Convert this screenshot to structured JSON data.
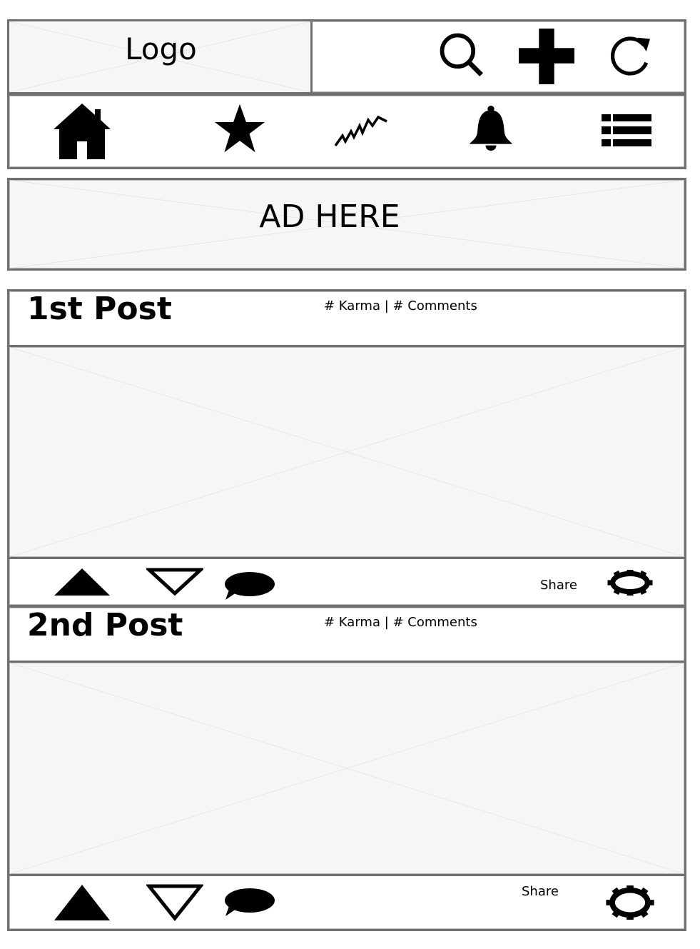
{
  "header": {
    "logo_text": "Logo",
    "actions": [
      {
        "name": "search",
        "icon": "search-icon"
      },
      {
        "name": "create",
        "icon": "plus-icon"
      },
      {
        "name": "refresh",
        "icon": "refresh-icon"
      }
    ]
  },
  "nav": {
    "items": [
      {
        "name": "home",
        "icon": "home-icon"
      },
      {
        "name": "favorites",
        "icon": "star-icon"
      },
      {
        "name": "trending",
        "icon": "trending-icon"
      },
      {
        "name": "notifications",
        "icon": "bell-icon"
      },
      {
        "name": "menu",
        "icon": "list-icon"
      }
    ]
  },
  "ad": {
    "text": "AD HERE"
  },
  "posts": [
    {
      "title": "1st Post",
      "meta": "# Karma | # Comments",
      "share_label": "Share"
    },
    {
      "title": "2nd Post",
      "meta": "# Karma | # Comments",
      "share_label": "Share"
    }
  ],
  "colors": {
    "border": "#707070",
    "placeholder_fill": "#f6f6f6",
    "placeholder_lines": "#d0d0d0",
    "icon": "#000000"
  }
}
